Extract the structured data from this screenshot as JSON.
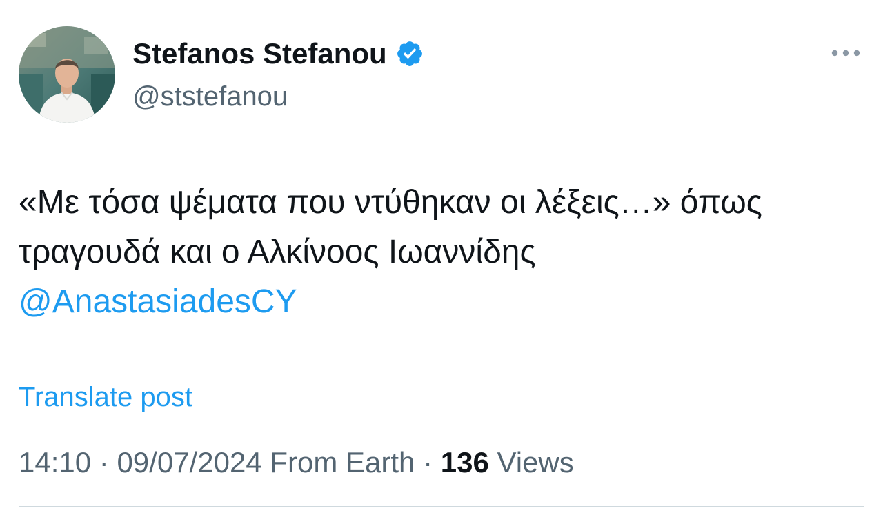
{
  "post": {
    "author": {
      "name": "Stefanos Stefanou",
      "handle": "@ststefanou",
      "verified_color": "#1d9bf0"
    },
    "text": {
      "line1": "«Με τόσα ψέματα που ντύθηκαν οι λέξεις…» όπως",
      "line2": "τραγουδά και ο Αλκίνοος Ιωαννίδης",
      "mention": "@AnastasiadesCY"
    },
    "translate_label": "Translate post",
    "meta": {
      "time": "14:10",
      "separator": "·",
      "date": "09/07/2024",
      "source": "From Earth",
      "views_count": "136",
      "views_label": "Views"
    },
    "icons": {
      "verified": "verified-badge-icon",
      "more": "more-horizontal-icon"
    },
    "colors": {
      "link": "#1d9bf0",
      "secondary_text": "#536471",
      "primary_text": "#0f1419"
    }
  }
}
